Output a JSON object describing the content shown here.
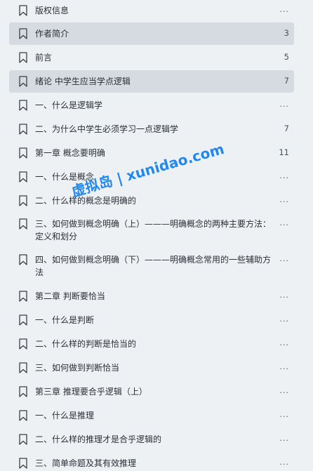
{
  "toc": {
    "items": [
      {
        "title": "版权信息",
        "page": "...",
        "selected": false
      },
      {
        "title": "作者简介",
        "page": "3",
        "selected": true
      },
      {
        "title": "前言",
        "page": "5",
        "selected": false
      },
      {
        "title": "绪论 中学生应当学点逻辑",
        "page": "7",
        "selected": true
      },
      {
        "title": "一、什么是逻辑学",
        "page": "...",
        "selected": false
      },
      {
        "title": "二、为什么中学生必须学习一点逻辑学",
        "page": "7",
        "selected": false
      },
      {
        "title": "第一章 概念要明确",
        "page": "11",
        "selected": false
      },
      {
        "title": "一、什么是概念",
        "page": "...",
        "selected": false
      },
      {
        "title": "二、什么样的概念是明确的",
        "page": "...",
        "selected": false
      },
      {
        "title": "三、如何做到概念明确（上）———明确概念的两种主要方法：定义和划分",
        "page": "...",
        "selected": false
      },
      {
        "title": "四、如何做到概念明确（下）———明确概念常用的一些辅助方法",
        "page": "...",
        "selected": false
      },
      {
        "title": "第二章 判断要恰当",
        "page": "...",
        "selected": false
      },
      {
        "title": "一、什么是判断",
        "page": "...",
        "selected": false
      },
      {
        "title": "二、什么样的判断是恰当的",
        "page": "...",
        "selected": false
      },
      {
        "title": "三、如何做到判断恰当",
        "page": "...",
        "selected": false
      },
      {
        "title": "第三章 推理要合乎逻辑（上）",
        "page": "...",
        "selected": false
      },
      {
        "title": "一、什么是推理",
        "page": "...",
        "selected": false
      },
      {
        "title": "二、什么样的推理才是合乎逻辑的",
        "page": "...",
        "selected": false
      },
      {
        "title": "三、简单命题及其有效推理",
        "page": "...",
        "selected": false
      }
    ]
  },
  "watermark": {
    "text": "虚拟岛 | xunidao.com"
  },
  "colors": {
    "background": "#eef1f4",
    "selected_row": "#d5dbe0",
    "watermark": "#1583ee"
  },
  "icons": {
    "row_icon": "bookmark-outline-icon"
  }
}
